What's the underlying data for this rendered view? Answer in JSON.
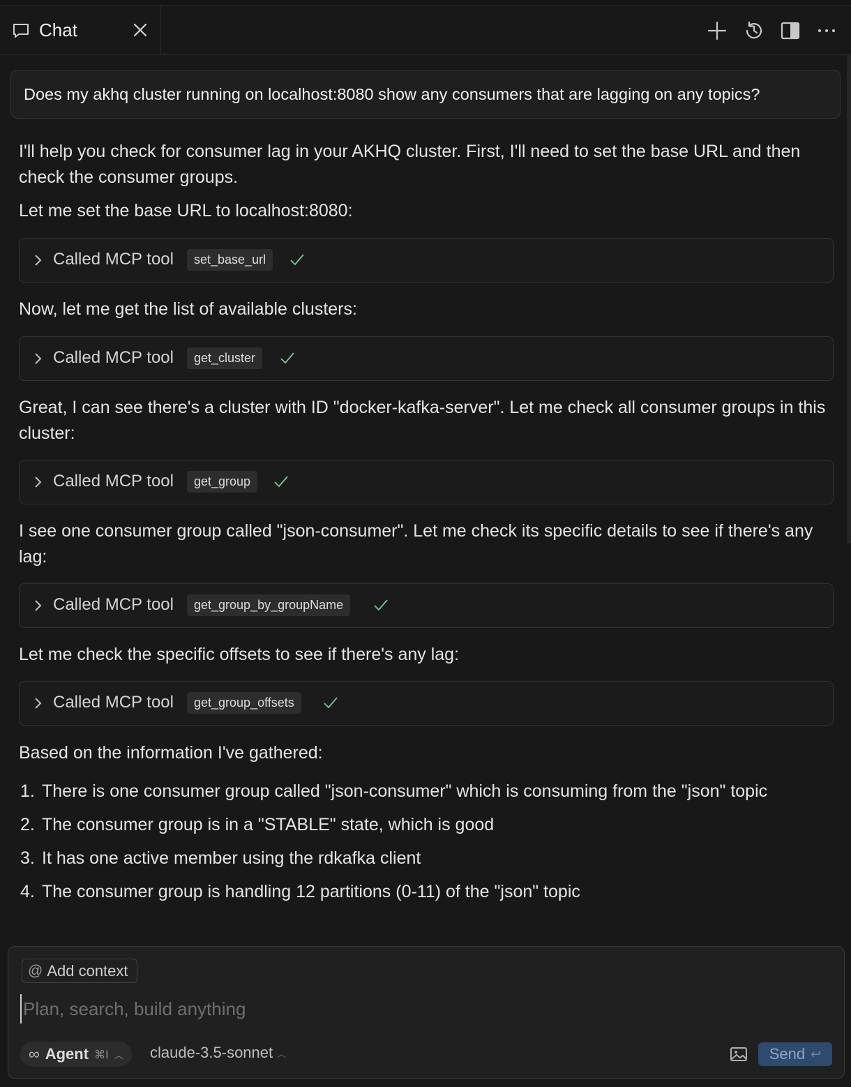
{
  "tab": {
    "title": "Chat"
  },
  "toolbar": {
    "new_icon": "plus-icon",
    "history_icon": "history-icon",
    "layout_icon": "sidebar-toggle-icon",
    "more_icon": "more-icon"
  },
  "conversation": {
    "user_message": "Does my akhq cluster running on localhost:8080 show any consumers that are lagging on any topics?",
    "blocks": [
      {
        "type": "text",
        "text": "I'll help you check for consumer lag in your AKHQ cluster. First, I'll need to set the base URL and then check the consumer groups."
      },
      {
        "type": "text",
        "text": "Let me set the base URL to localhost:8080:"
      },
      {
        "type": "tool",
        "label": "Called MCP tool",
        "name": "set_base_url"
      },
      {
        "type": "text",
        "text": "Now, let me get the list of available clusters:"
      },
      {
        "type": "tool",
        "label": "Called MCP tool",
        "name": "get_cluster"
      },
      {
        "type": "text",
        "text": "Great, I can see there's a cluster with ID \"docker-kafka-server\". Let me check all consumer groups in this cluster:"
      },
      {
        "type": "tool",
        "label": "Called MCP tool",
        "name": "get_group"
      },
      {
        "type": "text",
        "text": "I see one consumer group called \"json-consumer\". Let me check its specific details to see if there's any lag:"
      },
      {
        "type": "tool",
        "label": "Called MCP tool",
        "name": "get_group_by_groupName"
      },
      {
        "type": "text",
        "text": "Let me check the specific offsets to see if there's any lag:"
      },
      {
        "type": "tool",
        "label": "Called MCP tool",
        "name": "get_group_offsets"
      },
      {
        "type": "text",
        "text": "Based on the information I've gathered:"
      }
    ],
    "summary": [
      {
        "num": "1.",
        "text": "There is one consumer group called \"json-consumer\" which is consuming from the \"json\" topic"
      },
      {
        "num": "2.",
        "text": "The consumer group is in a \"STABLE\" state, which is good"
      },
      {
        "num": "3.",
        "text": "It has one active member using the rdkafka client"
      },
      {
        "num": "4.",
        "text": "The consumer group is handling 12 partitions (0-11) of the \"json\" topic"
      }
    ]
  },
  "composer": {
    "add_context": "Add context",
    "placeholder": "Plan, search, build anything",
    "value": "",
    "mode": "Agent",
    "mode_shortcut": "⌘I",
    "model": "claude-3.5-sonnet",
    "send": "Send"
  },
  "colors": {
    "accent": "#2e4a6e",
    "check": "#73c991",
    "background": "#181818"
  }
}
